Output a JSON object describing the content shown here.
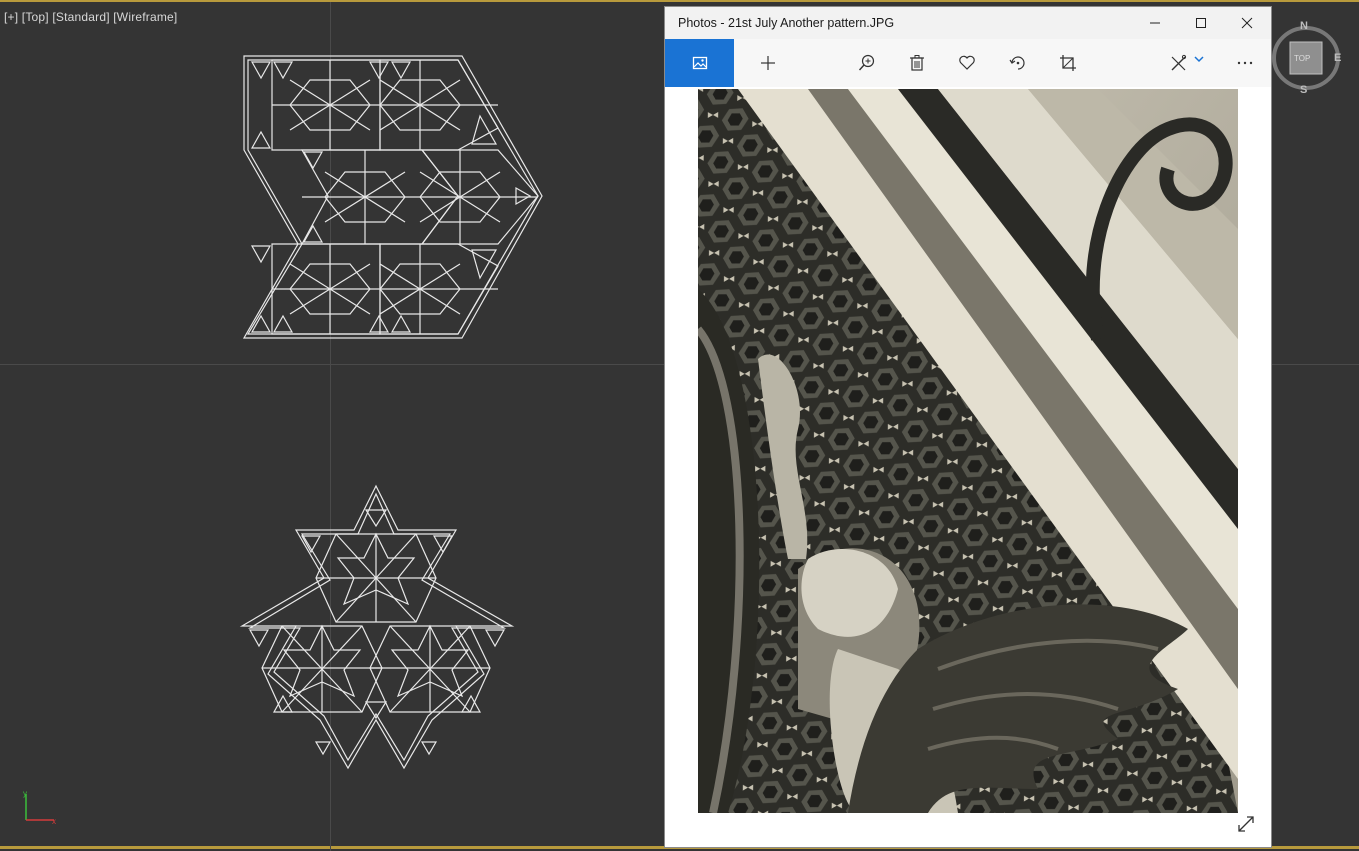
{
  "viewport": {
    "label": "[+] [Top] [Standard] [Wireframe]",
    "accent_color": "#b89a3c",
    "background": "#343434"
  },
  "viewcube": {
    "north": "N",
    "south": "S",
    "east": "E",
    "face": "TOP"
  },
  "axis_gizmo": {
    "x_color": "#d33b3b",
    "y_color": "#3bbf3b"
  },
  "photos": {
    "title": "Photos - 21st July Another pattern.JPG",
    "toolbar": [
      {
        "name": "collection-icon",
        "active": true
      },
      {
        "name": "add-icon"
      },
      {
        "name": "zoom-icon"
      },
      {
        "name": "delete-icon"
      },
      {
        "name": "favorite-icon"
      },
      {
        "name": "rotate-icon"
      },
      {
        "name": "crop-icon"
      },
      {
        "name": "edit-icon"
      },
      {
        "name": "more-icon"
      }
    ],
    "accent_color": "#1a73d4"
  }
}
